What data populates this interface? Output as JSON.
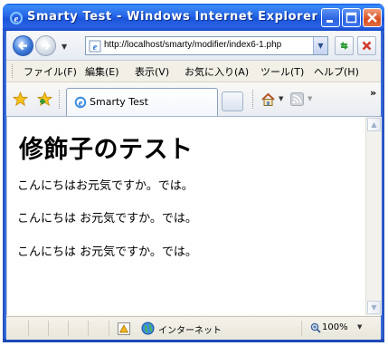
{
  "window": {
    "title": "Smarty Test - Windows Internet Explorer"
  },
  "address_bar": {
    "url": "http://localhost/smarty/modifier/index6-1.php"
  },
  "menu": {
    "items": [
      "ファイル(F)",
      "編集(E)",
      "表示(V)",
      "お気に入り(A)",
      "ツール(T)",
      "ヘルプ(H)"
    ]
  },
  "tabs": [
    {
      "label": "Smarty Test"
    }
  ],
  "page": {
    "heading": "修飾子のテスト",
    "paragraphs": [
      "こんにちはお元気ですか。では。",
      "こんにちは お元気ですか。では。",
      "こんにちは お元気ですか。では。"
    ]
  },
  "status": {
    "zone": "インターネット",
    "zoom": "100%"
  },
  "colors": {
    "titlebar": "#2766e8",
    "page_background": "#ffffff"
  },
  "icons": [
    "ie-icon",
    "back-arrow-icon",
    "forward-arrow-icon",
    "page-icon",
    "refresh-icon",
    "stop-icon",
    "favorites-star-icon",
    "add-favorites-icon",
    "home-icon",
    "feed-icon",
    "warning-icon",
    "globe-icon",
    "zoom-icon"
  ]
}
